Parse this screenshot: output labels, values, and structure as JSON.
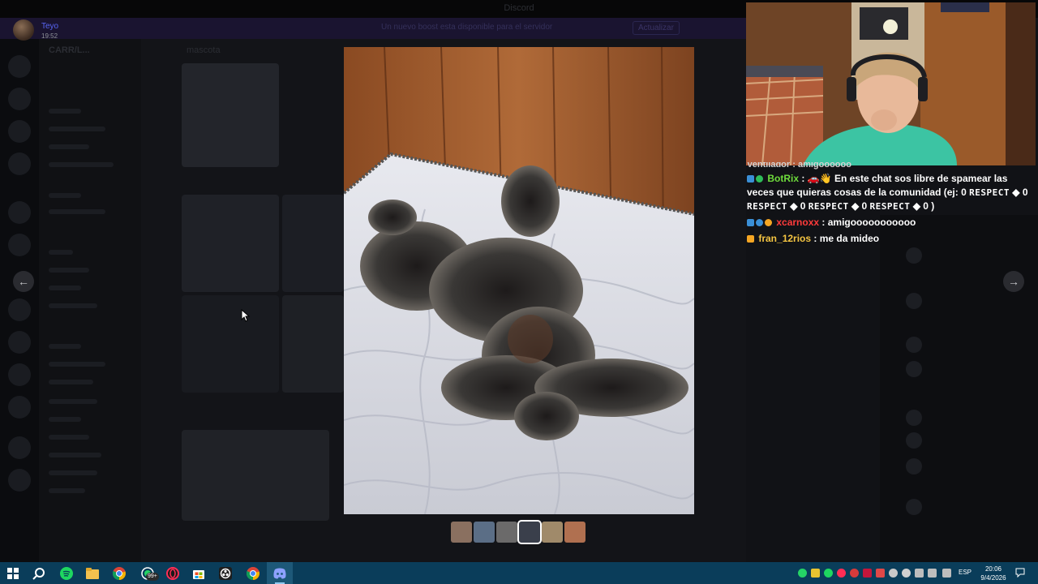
{
  "window": {
    "title": "Discord"
  },
  "banner": {
    "text": "Un nuevo boost esta disponible para el servidor",
    "button": "Actualizar"
  },
  "server": {
    "name": "CARR/L...",
    "channel": "mascota"
  },
  "viewer": {
    "user_name": "Teyo",
    "timestamp": "19:52",
    "prev_icon": "arrow-left-icon",
    "next_icon": "arrow-right-icon",
    "thumbnails": [
      {
        "name": "thumbnail-1",
        "color": "#8a7060"
      },
      {
        "name": "thumbnail-2",
        "color": "#5b6e86"
      },
      {
        "name": "thumbnail-3",
        "color": "#6b6a6a"
      },
      {
        "name": "thumbnail-4",
        "color": "#3a3f4b",
        "active": true
      },
      {
        "name": "thumbnail-5",
        "color": "#a08a6a"
      },
      {
        "name": "thumbnail-6",
        "color": "#b07050"
      }
    ]
  },
  "chat": {
    "partial_line": "Ventilador : amigoooooo",
    "messages": [
      {
        "user": "BotRix",
        "user_color": "#6fdc3c",
        "badges": [
          "#3a8fd6",
          "#2ebd59"
        ],
        "text": "En este chat sos libre de spamear las veces que quieras cosas de la comunidad (ej: 0 RESPECT ◆ 0 RESPECT ◆ 0 RESPECT ◆ 0 RESPECT ◆ 0 )"
      },
      {
        "user": "xcarnoxx",
        "user_color": "#ff3b3b",
        "badges": [
          "#3a8fd6",
          "#3a8fd6",
          "#f5a623"
        ],
        "text": "amigooooooooooo"
      },
      {
        "user": "fran_12rios",
        "user_color": "#f5c542",
        "badges": [
          "#f5a623"
        ],
        "text": "me da mideo"
      }
    ],
    "respect_word": "RESPECT"
  },
  "taskbar": {
    "apps": [
      {
        "name": "windows-start-icon"
      },
      {
        "name": "search-icon"
      },
      {
        "name": "spotify-icon"
      },
      {
        "name": "file-explorer-icon"
      },
      {
        "name": "chrome-icon"
      },
      {
        "name": "whatsapp-icon",
        "badge": "99+"
      },
      {
        "name": "opera-gx-icon"
      },
      {
        "name": "store-icon"
      },
      {
        "name": "obs-icon"
      },
      {
        "name": "chrome-profile-icon"
      },
      {
        "name": "discord-icon",
        "active": true
      }
    ],
    "language": "ESP",
    "time": "20:06",
    "date": "9/4/2026"
  }
}
